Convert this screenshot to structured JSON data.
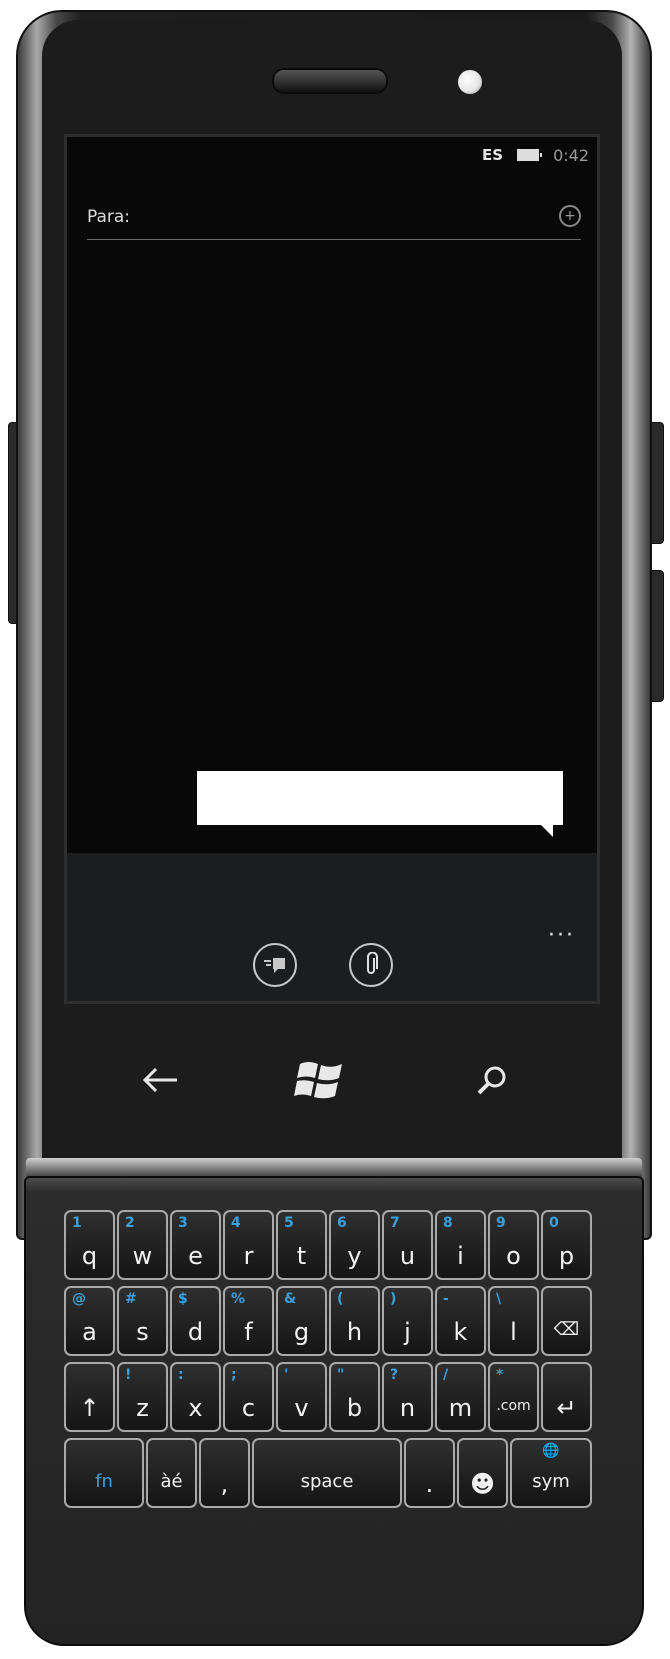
{
  "status_bar": {
    "language": "ES",
    "time": "0:42"
  },
  "compose": {
    "to_label": "Para:",
    "to_value": "",
    "add_contact_icon": "add-contact-icon"
  },
  "message": {
    "text": ""
  },
  "app_bar": {
    "buttons": [
      "send-icon",
      "attach-icon"
    ],
    "more": "···"
  },
  "hardware_keys": [
    "back-arrow-icon",
    "windows-logo-icon",
    "search-icon"
  ],
  "keyboard": {
    "row1": [
      {
        "alt": "1",
        "main": "q"
      },
      {
        "alt": "2",
        "main": "w"
      },
      {
        "alt": "3",
        "main": "e"
      },
      {
        "alt": "4",
        "main": "r"
      },
      {
        "alt": "5",
        "main": "t"
      },
      {
        "alt": "6",
        "main": "y"
      },
      {
        "alt": "7",
        "main": "u"
      },
      {
        "alt": "8",
        "main": "i"
      },
      {
        "alt": "9",
        "main": "o"
      },
      {
        "alt": "0",
        "main": "p"
      }
    ],
    "row2": [
      {
        "alt": "@",
        "main": "a"
      },
      {
        "alt": "#",
        "main": "s"
      },
      {
        "alt": "$",
        "main": "d"
      },
      {
        "alt": "%",
        "main": "f"
      },
      {
        "alt": "&",
        "main": "g"
      },
      {
        "alt": "(",
        "main": "h"
      },
      {
        "alt": ")",
        "main": "j"
      },
      {
        "alt": "-",
        "main": "k"
      },
      {
        "alt": "\\",
        "main": "l"
      },
      {
        "alt": "",
        "main": "⌫"
      }
    ],
    "row3": [
      {
        "alt": "",
        "main": "↑"
      },
      {
        "alt": "!",
        "main": "z"
      },
      {
        "alt": ":",
        "main": "x"
      },
      {
        "alt": ";",
        "main": "c"
      },
      {
        "alt": "'",
        "main": "v"
      },
      {
        "alt": "\"",
        "main": "b"
      },
      {
        "alt": "?",
        "main": "n"
      },
      {
        "alt": "/",
        "main": "m"
      },
      {
        "alt": "*",
        "main": ".com"
      },
      {
        "alt": "",
        "main": "↵"
      }
    ],
    "row4": [
      {
        "alt": "",
        "main": "fn"
      },
      {
        "alt": "",
        "main": "àé"
      },
      {
        "alt": "",
        "main": ","
      },
      {
        "alt": "",
        "main": "space"
      },
      {
        "alt": "",
        "main": "."
      },
      {
        "alt": "",
        "main": "☻"
      },
      {
        "alt": "",
        "main": "sym"
      }
    ]
  }
}
